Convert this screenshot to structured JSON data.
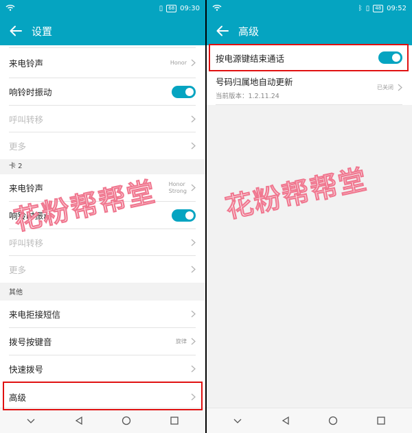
{
  "left": {
    "status": {
      "time": "09:30",
      "battery": "68"
    },
    "title": "设置",
    "top_rows": [
      {
        "label": "来电铃声",
        "value": "Honor"
      },
      {
        "label": "响铃时振动"
      },
      {
        "label": "呼叫转移"
      },
      {
        "label": "更多"
      }
    ],
    "section_card2": "卡 2",
    "card2_rows": [
      {
        "label": "来电铃声",
        "value": "Honor\nStrong"
      },
      {
        "label": "响铃时振动"
      },
      {
        "label": "呼叫转移"
      },
      {
        "label": "更多"
      }
    ],
    "section_other": "其他",
    "other_rows": [
      {
        "label": "来电拒接短信"
      },
      {
        "label": "拨号按键音",
        "value": "旋律"
      },
      {
        "label": "快速拨号"
      },
      {
        "label": "高级"
      }
    ]
  },
  "right": {
    "status": {
      "time": "09:52",
      "battery": "48"
    },
    "title": "高级",
    "rows": [
      {
        "label": "按电源键结束通话"
      },
      {
        "label": "号码归属地自动更新",
        "sub": "当前版本：1.2.11.24",
        "value": "已关闭"
      }
    ]
  },
  "watermark": "花粉帮帮堂",
  "colors": {
    "accent": "#05a4c1",
    "highlight": "#e01010"
  }
}
